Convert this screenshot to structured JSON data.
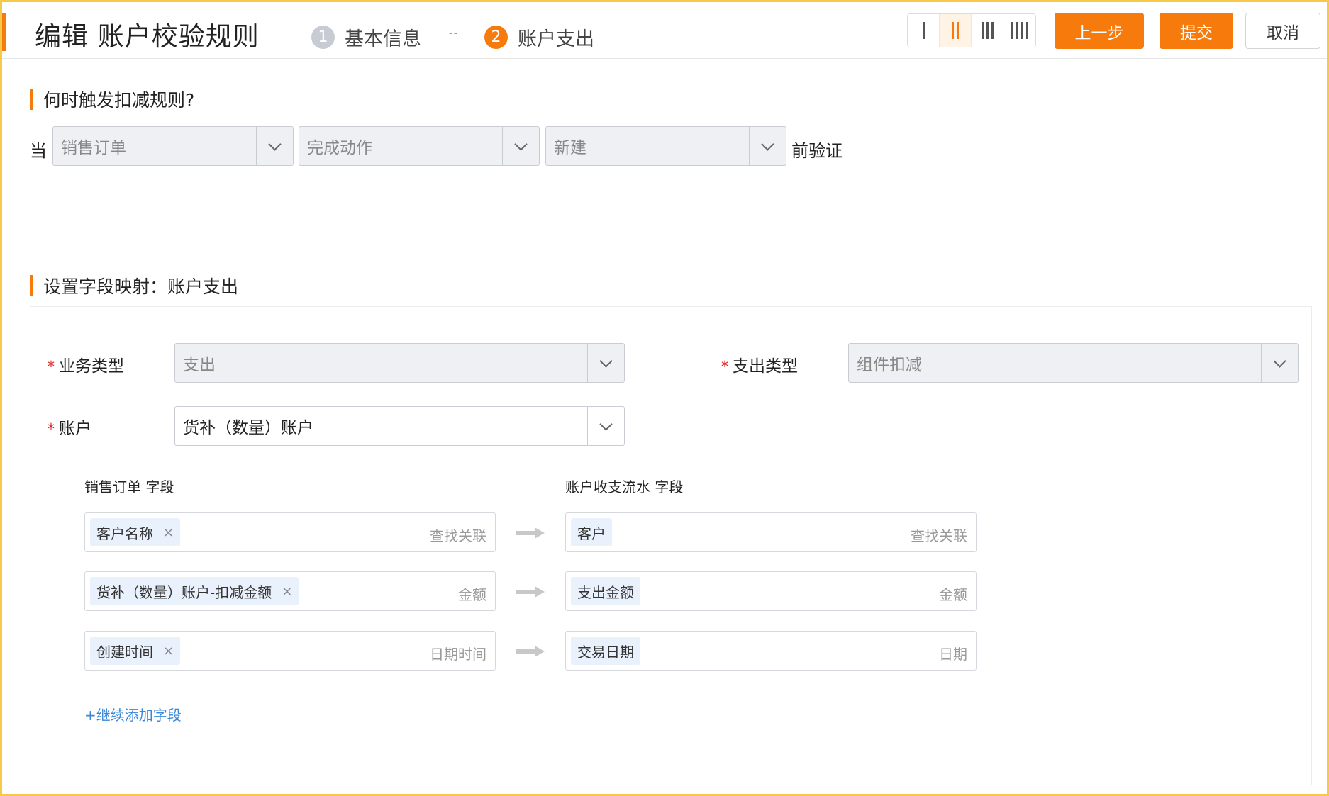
{
  "header": {
    "title": "编辑 账户校验规则",
    "steps": [
      {
        "num": "1",
        "label": "基本信息"
      },
      {
        "num": "2",
        "label": "账户支出"
      }
    ],
    "step_separator": "--",
    "layout_options": [
      "layout-1-col",
      "layout-2-col",
      "layout-3-col",
      "layout-4-col"
    ],
    "layout_selected": 2,
    "prev_label": "上一步",
    "submit_label": "提交",
    "cancel_label": "取消"
  },
  "trigger": {
    "section_title": "何时触发扣减规则?",
    "prefix": "当",
    "object": "销售订单",
    "action": "完成动作",
    "event": "新建",
    "suffix": "前验证"
  },
  "mapping": {
    "section_title": "设置字段映射：账户支出",
    "business_type": {
      "label": "业务类型",
      "value": "支出"
    },
    "expense_type": {
      "label": "支出类型",
      "value": "组件扣减"
    },
    "account": {
      "label": "账户",
      "value": "货补（数量）账户"
    },
    "source_header": "销售订单 字段",
    "target_header": "账户收支流水 字段",
    "rows": [
      {
        "source_tag": "客户名称",
        "source_hint": "查找关联",
        "target_tag": "客户",
        "target_hint": "查找关联"
      },
      {
        "source_tag": "货补（数量）账户-扣减金额",
        "source_hint": "金额",
        "target_tag": "支出金额",
        "target_hint": "金额"
      },
      {
        "source_tag": "创建时间",
        "source_hint": "日期时间",
        "target_tag": "交易日期",
        "target_hint": "日期"
      }
    ],
    "remove_symbol": "×",
    "add_field_label": "+继续添加字段"
  },
  "colors": {
    "accent": "#f77a0c",
    "frame": "#f7c948",
    "link": "#3a87d8",
    "tag_bg": "#e8f1fc",
    "required": "#e02020"
  }
}
